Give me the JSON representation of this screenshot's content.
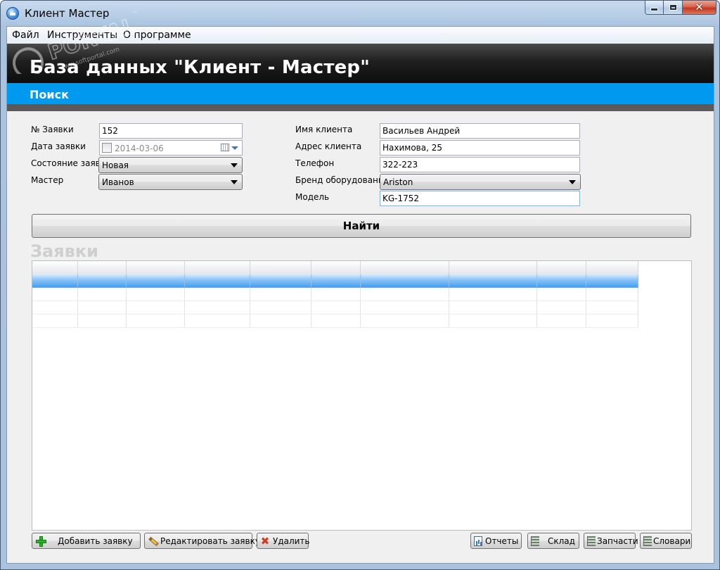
{
  "window": {
    "title": "Клиент Мастер",
    "close_glyph": "✕"
  },
  "menu": {
    "items": [
      "Файл",
      "Инструменты",
      "О программе"
    ]
  },
  "header": {
    "title": "База данных \"Клиент - Мастер\"",
    "subtitle": "Поиск"
  },
  "search": {
    "left": {
      "order_no_label": "№ Заявки",
      "order_no_value": "152",
      "date_label": "Дата заявки",
      "date_value": "2014-03-06",
      "status_label": "Состояние заявки",
      "status_value": "Новая",
      "master_label": "Мастер",
      "master_value": "Иванов"
    },
    "right": {
      "client_name_label": "Имя клиента",
      "client_name_value": "Васильев Андрей",
      "client_address_label": "Адрес клиента",
      "client_address_value": "Нахимова, 25",
      "phone_label": "Телефон",
      "phone_value": "322-223",
      "brand_label": "Бренд оборудования",
      "brand_value": "Ariston",
      "model_label": "Модель",
      "model_value": "KG-1752"
    },
    "find_button": "Найти"
  },
  "orders": {
    "section_title": "Заявки",
    "selected_row": 0
  },
  "footer": {
    "add_button": "Добавить заявку",
    "edit_button": "Редактировать заявку",
    "delete_button": "Удалить",
    "reports_button": "Отчеты",
    "warehouse_button": "Склад",
    "parts_button": "Запчасти",
    "dictionaries_button": "Словари",
    "delete_glyph": "✖"
  },
  "watermark": {
    "text": "PORTAL",
    "tm": "™",
    "url": "www.softportal.com"
  },
  "colors": {
    "header_band": "#1f1f1f",
    "accent_band": "#0099f0",
    "selected_row": "#3d9bf0"
  }
}
